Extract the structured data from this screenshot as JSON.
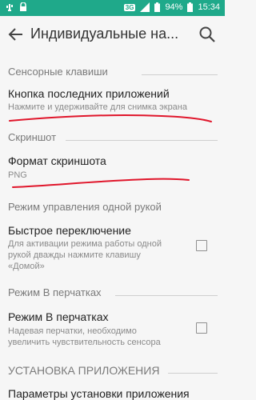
{
  "status_bar": {
    "network": "3G",
    "battery": "94%",
    "time": "15:34"
  },
  "app_bar": {
    "title": "Индивидуальные на..."
  },
  "sections": [
    {
      "header": "Сенсорные клавиши"
    },
    {
      "header": "Скриншот"
    },
    {
      "header": "Режим управления одной рукой"
    },
    {
      "header": "Режим В перчатках"
    },
    {
      "header": "УСТАНОВКА ПРИЛОЖЕНИЯ"
    }
  ],
  "items": {
    "recent_apps": {
      "title": "Кнопка последних приложений",
      "subtitle": "Нажмите и удерживайте для снимка экрана"
    },
    "screenshot_format": {
      "title": "Формат скриншота",
      "subtitle": "PNG"
    },
    "quick_switch": {
      "title": "Быстрое переключение",
      "subtitle_lines": [
        "Для активации режима работы одной",
        "рукой дважды нажмите клавишу",
        "«Домой»"
      ],
      "checked": false
    },
    "glove_mode": {
      "title": "Режим В перчатках",
      "subtitle_lines": [
        "Надевая перчатки, необходимо",
        "увеличить чувствительность сенсора"
      ],
      "checked": false
    },
    "install_settings": {
      "title": "Параметры установки приложения"
    }
  },
  "colors": {
    "status_bar": "#1fa98a",
    "background": "#f6f6f6",
    "annotation": "#e0162b"
  }
}
